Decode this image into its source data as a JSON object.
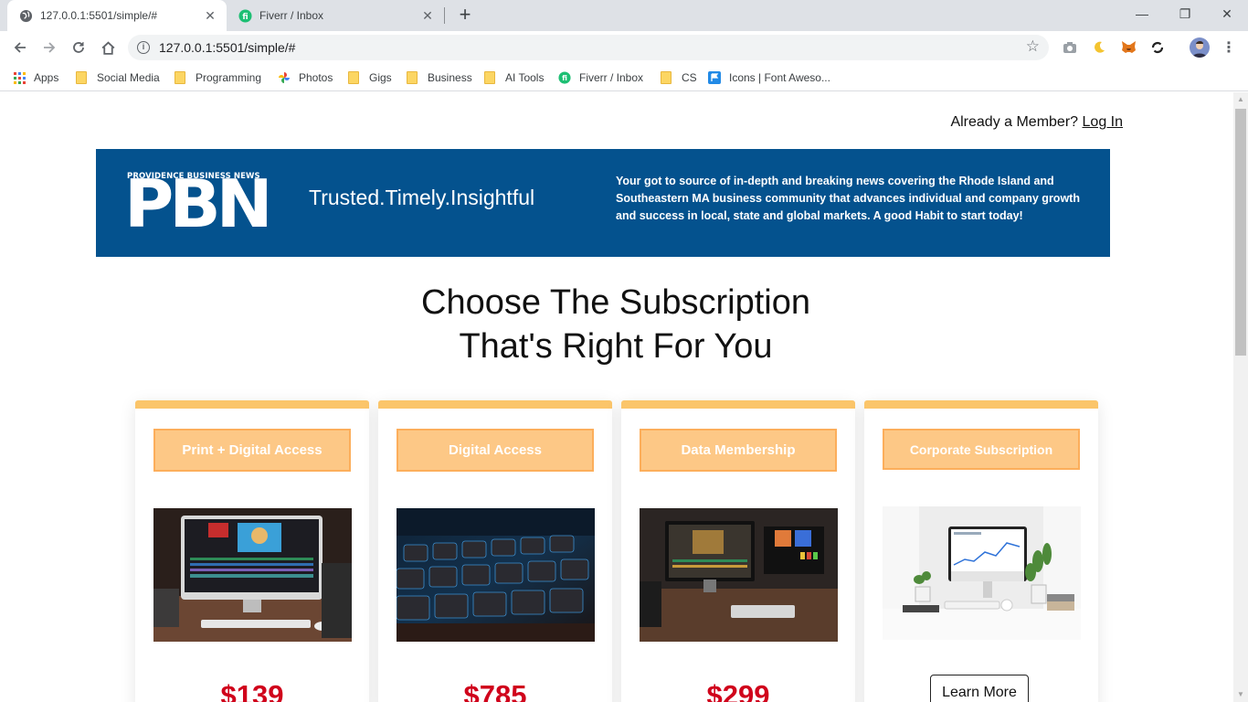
{
  "browser": {
    "tabs": [
      {
        "title": "127.0.0.1:5501/simple/#",
        "active": true
      },
      {
        "title": "Fiverr / Inbox",
        "active": false
      }
    ],
    "url": "127.0.0.1:5501/simple/#",
    "bookmarks": [
      {
        "label": "Apps",
        "icon": "apps-grid-icon"
      },
      {
        "label": "Social Media",
        "icon": "folder-icon"
      },
      {
        "label": "Programming",
        "icon": "folder-icon"
      },
      {
        "label": "Photos",
        "icon": "photos-icon"
      },
      {
        "label": "Gigs",
        "icon": "folder-icon"
      },
      {
        "label": "Business",
        "icon": "folder-icon"
      },
      {
        "label": "AI Tools",
        "icon": "folder-icon"
      },
      {
        "label": "Fiverr / Inbox",
        "icon": "fiverr-icon"
      },
      {
        "label": "CS",
        "icon": "folder-icon"
      },
      {
        "label": "Icons | Font Aweso...",
        "icon": "flag-icon"
      }
    ]
  },
  "header": {
    "member_text": "Already a Member?",
    "login_label": "Log In"
  },
  "banner": {
    "logo_small": "PROVIDENCE BUSINESS NEWS",
    "logo_big": "PBN",
    "tagline": "Trusted.Timely.Insightful",
    "description": "Your got to source of in-depth and breaking news covering the Rhode Island and Southeastern MA business community that advances individual and company growth and success in local, state and global markets. A good Habit to start today!",
    "bg_color": "#04528e"
  },
  "heading": {
    "line1": "Choose The Subscription",
    "line2": "That's Right For You"
  },
  "plans": [
    {
      "title": "Print + Digital Access",
      "price": "$139",
      "image": "imac-video-editing"
    },
    {
      "title": "Digital Access",
      "price": "$785",
      "image": "backlit-keyboard"
    },
    {
      "title": "Data Membership",
      "price": "$299",
      "image": "editing-desk-setup"
    },
    {
      "title": "Corporate Subscription",
      "cta": "Learn More",
      "image": "white-desk-imac"
    }
  ],
  "colors": {
    "accent": "#fbc56a",
    "plan_button": "#fdc886",
    "price": "#d0021b"
  }
}
